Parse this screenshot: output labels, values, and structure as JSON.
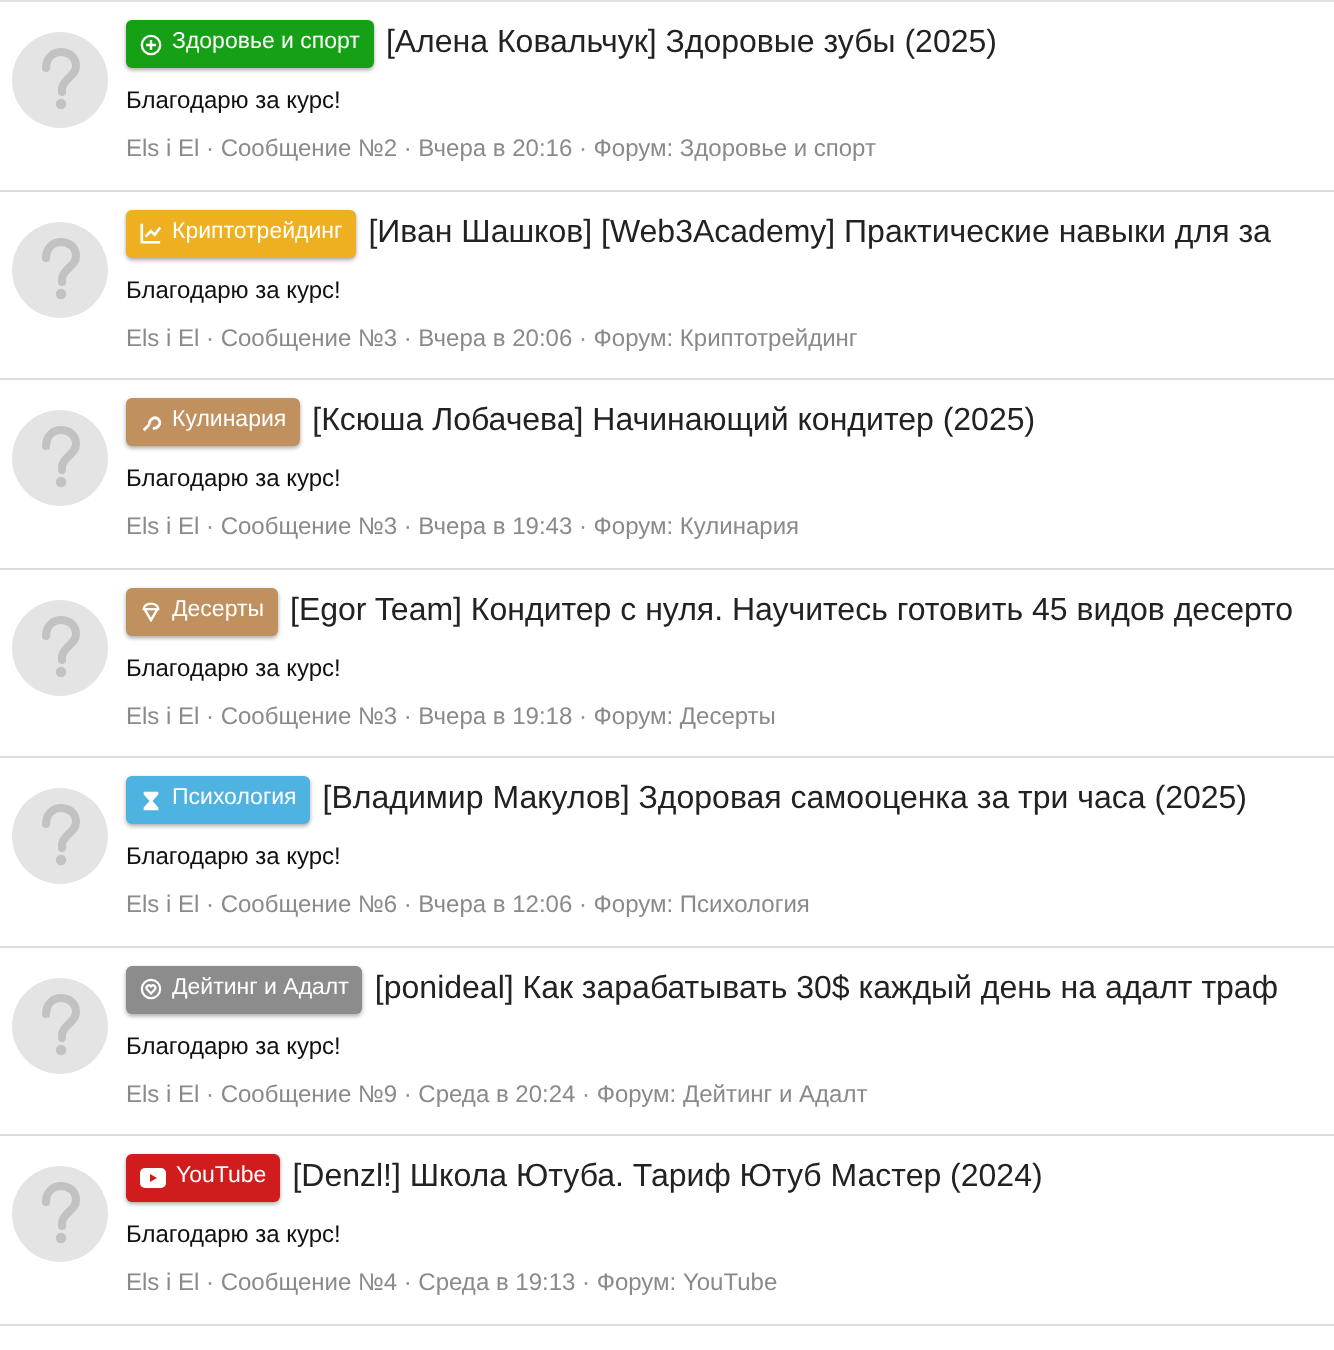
{
  "posts": [
    {
      "forum_badge": {
        "label": "Здоровье и спорт",
        "color": "#16a016"
      },
      "title": "[Алена Ковальчук] Здоровые зубы (2025)",
      "message": "Благодарю за курс!",
      "meta": "Els i El · Сообщение №2 · Вчера в 20:16 · Форум: Здоровье и спорт"
    },
    {
      "forum_badge": {
        "label": "Криптотрейдинг",
        "color": "#eeb021"
      },
      "title": "[Иван Шашков] [Web3Academy] Практические навыки для за",
      "message": "Благодарю за курс!",
      "meta": "Els i El · Сообщение №3 · Вчера в 20:06 · Форум: Криптотрейдинг"
    },
    {
      "forum_badge": {
        "label": "Кулинария",
        "color": "#c0915e"
      },
      "title": "[Ксюша Лобачева] Начинающий кондитер (2025)",
      "message": "Благодарю за курс!",
      "meta": "Els i El · Сообщение №3 · Вчера в 19:43 · Форум: Кулинария"
    },
    {
      "forum_badge": {
        "label": "Десерты",
        "color": "#c0915f"
      },
      "title": "[Egor Team] Кондитер с нуля. Научитесь готовить 45 видов десерто",
      "message": "Благодарю за курс!",
      "meta": "Els i El · Сообщение №3 · Вчера в 19:18 · Форум: Десерты"
    },
    {
      "forum_badge": {
        "label": "Психология",
        "color": "#4eb3e0"
      },
      "title": "[Владимир Макулов] Здоровая самооценка за три часа (2025)",
      "message": "Благодарю за курс!",
      "meta": "Els i El · Сообщение №6 · Вчера в 12:06 · Форум: Психология"
    },
    {
      "forum_badge": {
        "label": "Дейтинг и Адалт",
        "color": "#8c8c8c"
      },
      "title": "[ponideal] Как зарабатывать 30$ каждый день на адалт траф",
      "message": "Благодарю за курс!",
      "meta": "Els i El · Сообщение №9 · Среда в 20:24 · Форум: Дейтинг и Адалт"
    },
    {
      "forum_badge": {
        "label": "YouTube",
        "color": "#d01c1c"
      },
      "title": "[Denzl!] Школа Ютуба. Тариф Ютуб Мастер (2024)",
      "message": "Благодарю за курс!",
      "meta": "Els i El · Сообщение №4 · Среда в 19:13 · Форум: YouTube"
    }
  ]
}
